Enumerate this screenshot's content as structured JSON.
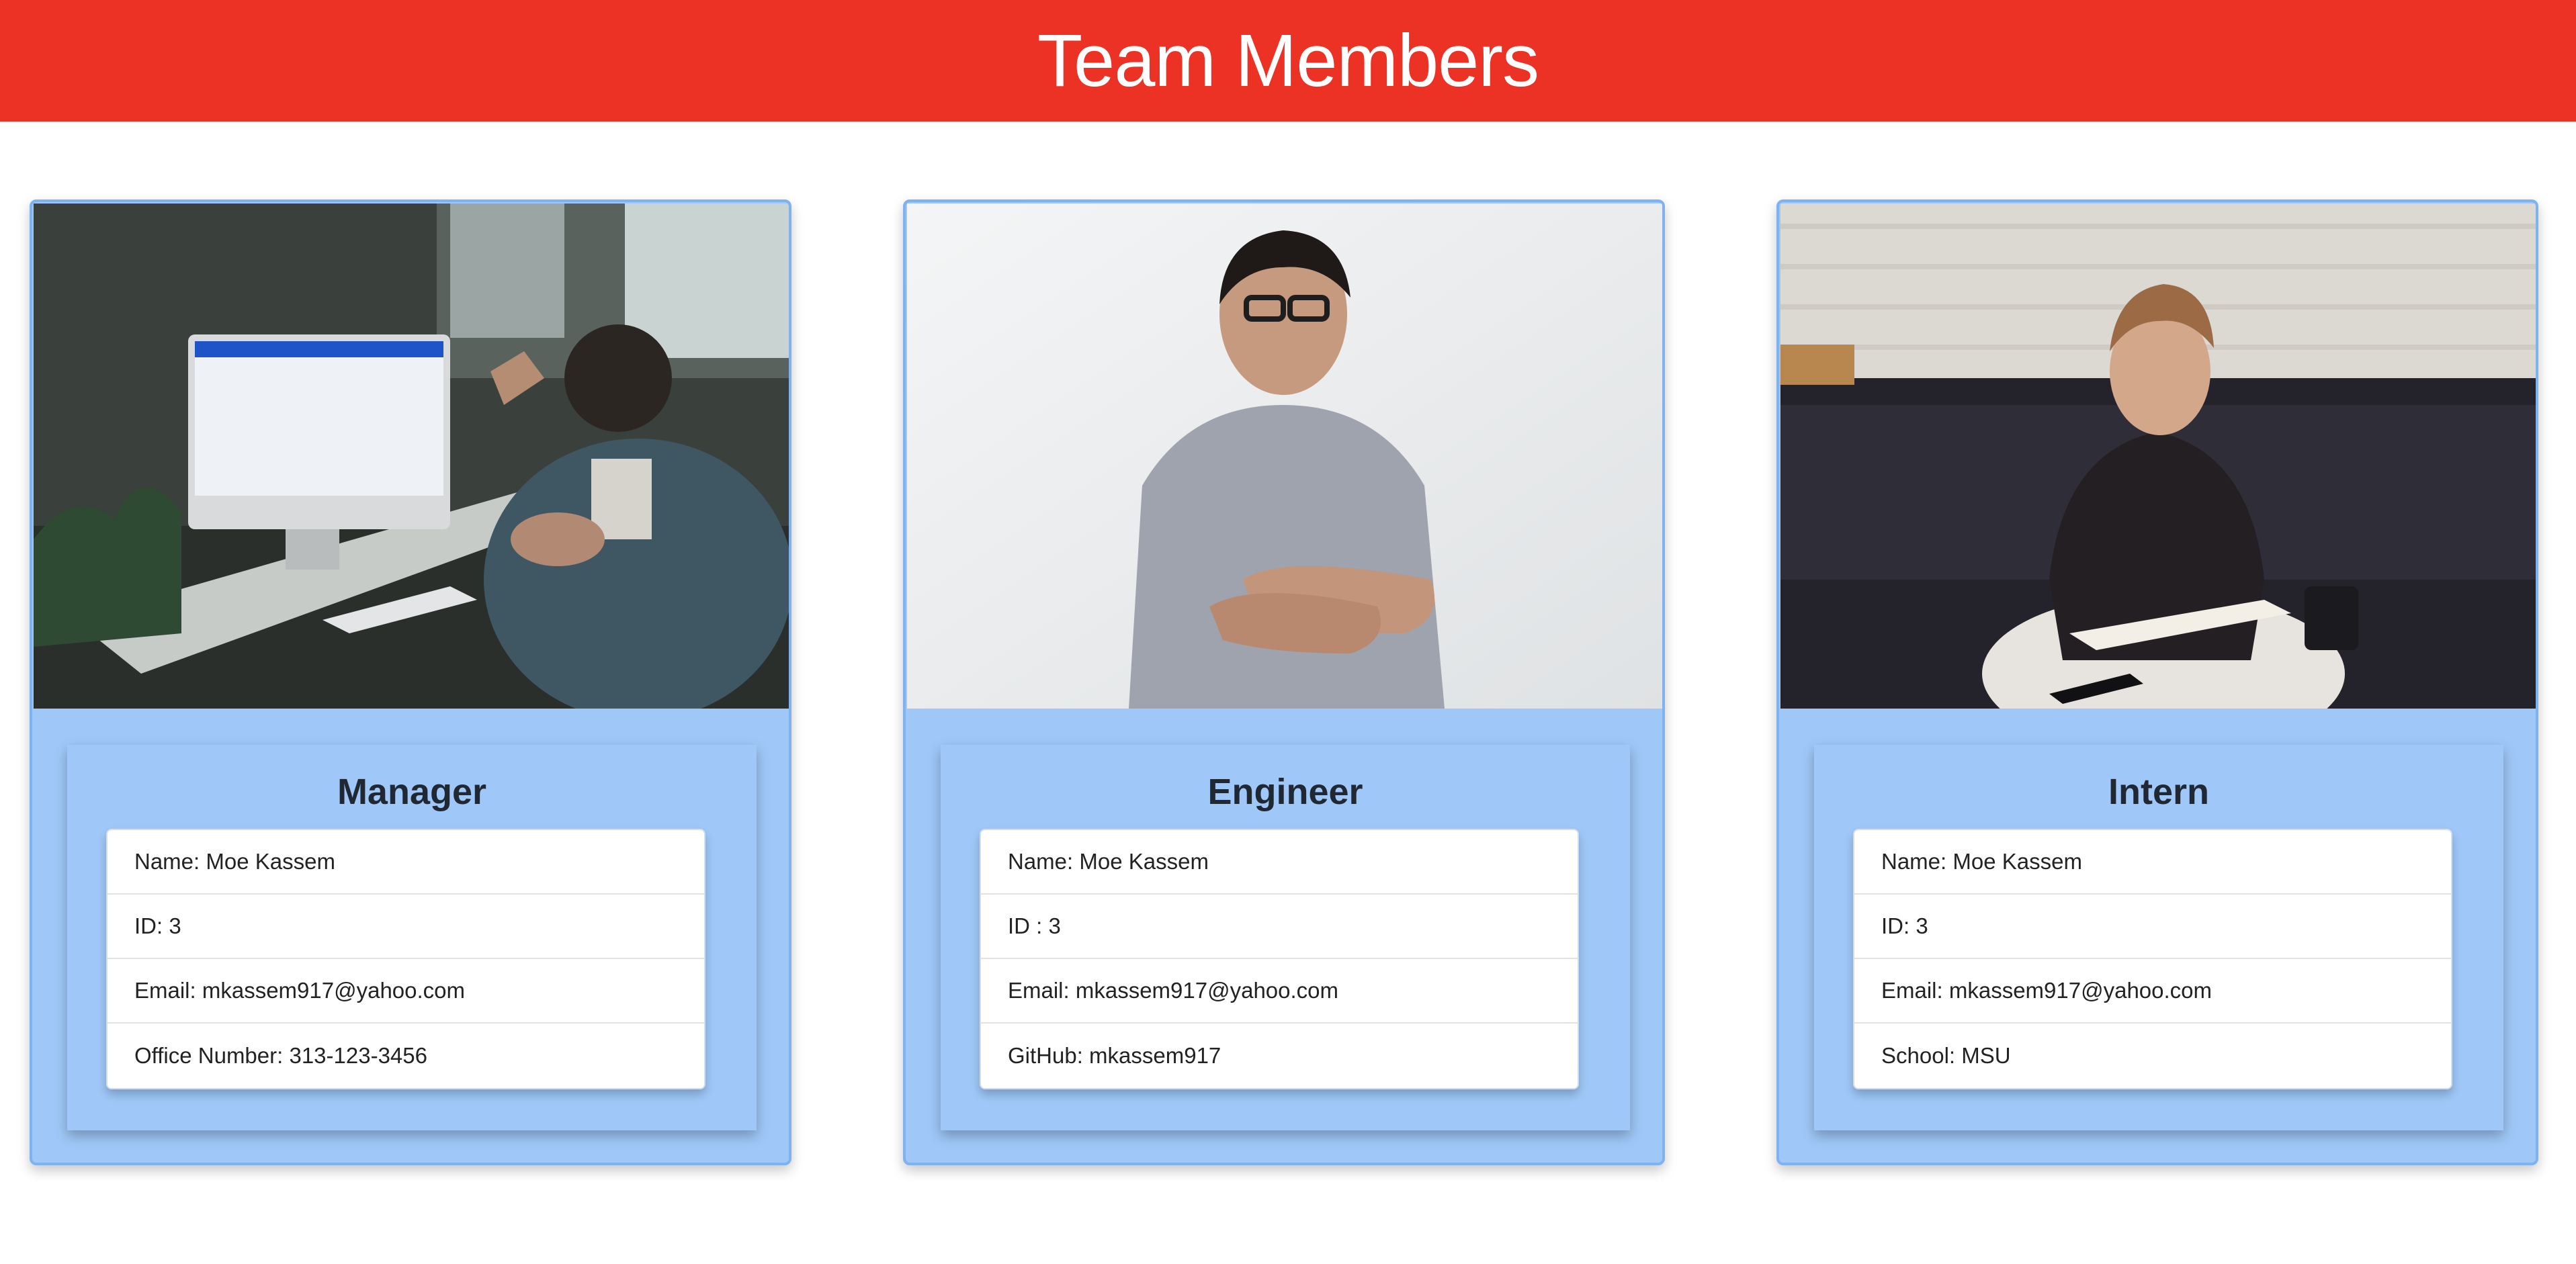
{
  "header": {
    "title": "Team Members"
  },
  "cards": [
    {
      "role": "Manager",
      "photo": "man-on-phone-at-desk-photo",
      "items": [
        "Name: Moe Kassem",
        "ID: 3",
        "Email: mkassem917@yahoo.com",
        "Office Number: 313-123-3456"
      ]
    },
    {
      "role": "Engineer",
      "photo": "man-arms-crossed-photo",
      "items": [
        "Name: Moe Kassem",
        "ID : 3",
        "Email: mkassem917@yahoo.com",
        "GitHub: mkassem917"
      ]
    },
    {
      "role": "Intern",
      "photo": "man-writing-in-notebook-photo",
      "items": [
        "Name: Moe Kassem",
        "ID: 3",
        "Email: mkassem917@yahoo.com",
        "School: MSU"
      ]
    }
  ],
  "colors": {
    "header": "#ec3224",
    "card": "#9fc8f8",
    "card_border": "#7fb2ef"
  }
}
